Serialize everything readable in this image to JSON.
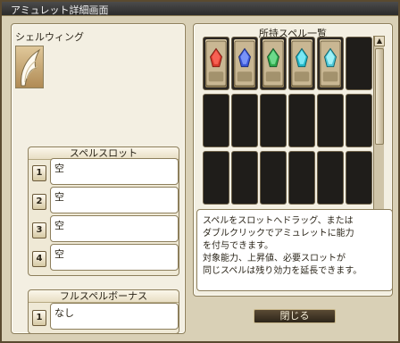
{
  "window": {
    "title": "アミュレット詳細画面"
  },
  "amulet": {
    "name": "シェルウィング",
    "icon": "white-wing-icon"
  },
  "spell_slots": {
    "header": "スペルスロット",
    "rows": [
      {
        "num": "1",
        "value": "空"
      },
      {
        "num": "2",
        "value": "空"
      },
      {
        "num": "3",
        "value": "空"
      },
      {
        "num": "4",
        "value": "空"
      }
    ]
  },
  "full_spell_bonus": {
    "header": "フルスペルボーナス",
    "rows": [
      {
        "num": "1",
        "value": "なし"
      }
    ]
  },
  "owned_spells": {
    "header": "所持スペル一覧",
    "cards": [
      {
        "icon": "red-crystal-card-icon",
        "color": "#d83a2c"
      },
      {
        "icon": "blue-crystal-card-icon",
        "color": "#3b57d8"
      },
      {
        "icon": "green-crystal-card-icon",
        "color": "#2fa84b"
      },
      {
        "icon": "cyan-crystal-card-icon",
        "color": "#24b7c7"
      },
      {
        "icon": "cyan-crystal-card-icon",
        "color": "#4cc6d6"
      }
    ]
  },
  "info": {
    "lines": [
      "スペルをスロットへドラッグ、または",
      "ダブルクリックでアミュレットに能力",
      "を付与できます。",
      "対象能力、上昇値、必要スロットが",
      "同じスペルは残り効力を延長できます。"
    ]
  },
  "close_label": "閉じる"
}
